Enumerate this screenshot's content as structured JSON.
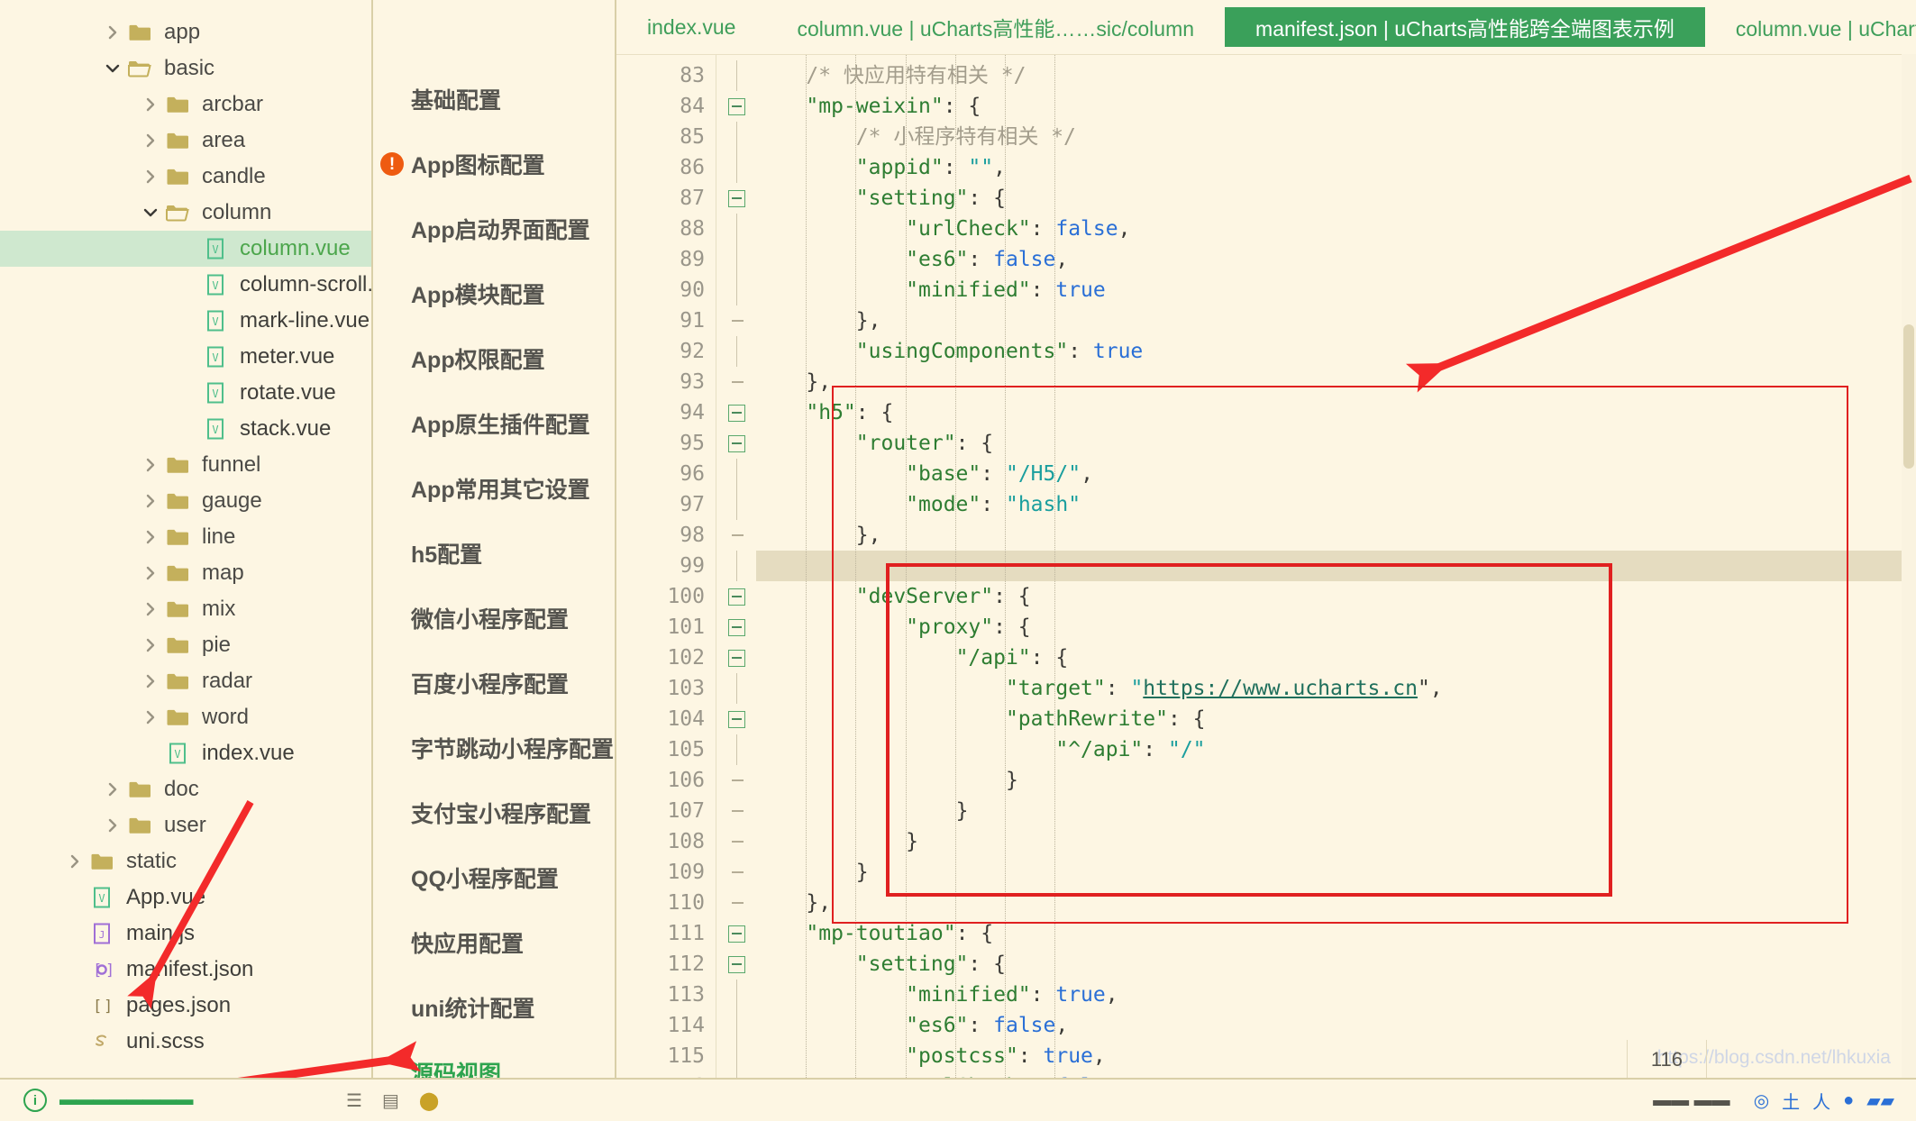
{
  "explorer": {
    "items": [
      {
        "label": "app",
        "type": "folder",
        "state": "collapsed",
        "depth": 1
      },
      {
        "label": "basic",
        "type": "folder-open",
        "state": "expanded",
        "depth": 1
      },
      {
        "label": "arcbar",
        "type": "folder",
        "state": "collapsed",
        "depth": 2
      },
      {
        "label": "area",
        "type": "folder",
        "state": "collapsed",
        "depth": 2
      },
      {
        "label": "candle",
        "type": "folder",
        "state": "collapsed",
        "depth": 2
      },
      {
        "label": "column",
        "type": "folder-open",
        "state": "expanded",
        "depth": 2
      },
      {
        "label": "column.vue",
        "type": "vue",
        "state": "selected",
        "depth": 3
      },
      {
        "label": "column-scroll.vue",
        "type": "vue",
        "state": "",
        "depth": 3
      },
      {
        "label": "mark-line.vue",
        "type": "vue",
        "state": "",
        "depth": 3
      },
      {
        "label": "meter.vue",
        "type": "vue",
        "state": "",
        "depth": 3
      },
      {
        "label": "rotate.vue",
        "type": "vue",
        "state": "",
        "depth": 3
      },
      {
        "label": "stack.vue",
        "type": "vue",
        "state": "",
        "depth": 3
      },
      {
        "label": "funnel",
        "type": "folder",
        "state": "collapsed",
        "depth": 2
      },
      {
        "label": "gauge",
        "type": "folder",
        "state": "collapsed",
        "depth": 2
      },
      {
        "label": "line",
        "type": "folder",
        "state": "collapsed",
        "depth": 2
      },
      {
        "label": "map",
        "type": "folder",
        "state": "collapsed",
        "depth": 2
      },
      {
        "label": "mix",
        "type": "folder",
        "state": "collapsed",
        "depth": 2
      },
      {
        "label": "pie",
        "type": "folder",
        "state": "collapsed",
        "depth": 2
      },
      {
        "label": "radar",
        "type": "folder",
        "state": "collapsed",
        "depth": 2
      },
      {
        "label": "word",
        "type": "folder",
        "state": "collapsed",
        "depth": 2
      },
      {
        "label": "index.vue",
        "type": "vue",
        "state": "",
        "depth": 2
      },
      {
        "label": "doc",
        "type": "folder",
        "state": "collapsed",
        "depth": 1
      },
      {
        "label": "user",
        "type": "folder",
        "state": "collapsed",
        "depth": 1
      },
      {
        "label": "static",
        "type": "folder",
        "state": "collapsed",
        "depth": 0
      },
      {
        "label": "App.vue",
        "type": "vue",
        "state": "",
        "depth": 0
      },
      {
        "label": "main.js",
        "type": "js",
        "state": "",
        "depth": 0
      },
      {
        "label": "manifest.json",
        "type": "manifest",
        "state": "",
        "depth": 0
      },
      {
        "label": "pages.json",
        "type": "pages",
        "state": "",
        "depth": 0
      },
      {
        "label": "uni.scss",
        "type": "scss",
        "state": "",
        "depth": 0
      }
    ]
  },
  "confignav": {
    "items": [
      {
        "label": "基础配置",
        "badge": "",
        "active": false
      },
      {
        "label": "App图标配置",
        "badge": "!",
        "active": false
      },
      {
        "label": "App启动界面配置",
        "badge": "",
        "active": false
      },
      {
        "label": "App模块配置",
        "badge": "",
        "active": false
      },
      {
        "label": "App权限配置",
        "badge": "",
        "active": false
      },
      {
        "label": "App原生插件配置",
        "badge": "",
        "active": false
      },
      {
        "label": "App常用其它设置",
        "badge": "",
        "active": false
      },
      {
        "label": "h5配置",
        "badge": "",
        "active": false
      },
      {
        "label": "微信小程序配置",
        "badge": "",
        "active": false
      },
      {
        "label": "百度小程序配置",
        "badge": "",
        "active": false
      },
      {
        "label": "字节跳动小程序配置",
        "badge": "",
        "active": false
      },
      {
        "label": "支付宝小程序配置",
        "badge": "",
        "active": false
      },
      {
        "label": "QQ小程序配置",
        "badge": "",
        "active": false
      },
      {
        "label": "快应用配置",
        "badge": "",
        "active": false
      },
      {
        "label": "uni统计配置",
        "badge": "",
        "active": false
      },
      {
        "label": "源码视图",
        "badge": "",
        "active": true
      }
    ]
  },
  "tabs": {
    "items": [
      {
        "label": "index.vue",
        "active": false
      },
      {
        "label": "column.vue | uCharts高性能……sic/column",
        "active": false
      },
      {
        "label": "manifest.json | uCharts高性能跨全端图表示例",
        "active": true
      },
      {
        "label": "column.vue | uCharts高性能……sic/colum",
        "active": false
      }
    ],
    "overflow_icon": "chevron-left-icon"
  },
  "code": {
    "first_line": 83,
    "highlight_line": 99,
    "lines": [
      {
        "n": 83,
        "fold": "bar",
        "indent": 1,
        "tokens": [
          {
            "t": "/* 快应用特有相关 */",
            "c": "cmt"
          }
        ]
      },
      {
        "n": 84,
        "fold": "box",
        "indent": 1,
        "tokens": [
          {
            "t": "\"mp-weixin\"",
            "c": "key"
          },
          {
            "t": ": {",
            "c": "pun"
          }
        ]
      },
      {
        "n": 85,
        "fold": "bar",
        "indent": 2,
        "tokens": [
          {
            "t": "/* 小程序特有相关 */",
            "c": "cmt"
          }
        ]
      },
      {
        "n": 86,
        "fold": "bar",
        "indent": 2,
        "tokens": [
          {
            "t": "\"appid\"",
            "c": "key"
          },
          {
            "t": ": ",
            "c": "pun"
          },
          {
            "t": "\"\"",
            "c": "str"
          },
          {
            "t": ",",
            "c": "pun"
          }
        ]
      },
      {
        "n": 87,
        "fold": "box",
        "indent": 2,
        "tokens": [
          {
            "t": "\"setting\"",
            "c": "key"
          },
          {
            "t": ": {",
            "c": "pun"
          }
        ]
      },
      {
        "n": 88,
        "fold": "bar",
        "indent": 3,
        "tokens": [
          {
            "t": "\"urlCheck\"",
            "c": "key"
          },
          {
            "t": ": ",
            "c": "pun"
          },
          {
            "t": "false",
            "c": "bool"
          },
          {
            "t": ",",
            "c": "pun"
          }
        ]
      },
      {
        "n": 89,
        "fold": "bar",
        "indent": 3,
        "tokens": [
          {
            "t": "\"es6\"",
            "c": "key"
          },
          {
            "t": ": ",
            "c": "pun"
          },
          {
            "t": "false",
            "c": "bool"
          },
          {
            "t": ",",
            "c": "pun"
          }
        ]
      },
      {
        "n": 90,
        "fold": "bar",
        "indent": 3,
        "tokens": [
          {
            "t": "\"minified\"",
            "c": "key"
          },
          {
            "t": ": ",
            "c": "pun"
          },
          {
            "t": "true",
            "c": "bool"
          }
        ]
      },
      {
        "n": 91,
        "fold": "dash",
        "indent": 2,
        "tokens": [
          {
            "t": "},",
            "c": "pun"
          }
        ]
      },
      {
        "n": 92,
        "fold": "bar",
        "indent": 2,
        "tokens": [
          {
            "t": "\"usingComponents\"",
            "c": "key"
          },
          {
            "t": ": ",
            "c": "pun"
          },
          {
            "t": "true",
            "c": "bool"
          }
        ]
      },
      {
        "n": 93,
        "fold": "dash",
        "indent": 1,
        "tokens": [
          {
            "t": "},",
            "c": "pun"
          }
        ]
      },
      {
        "n": 94,
        "fold": "box",
        "indent": 1,
        "tokens": [
          {
            "t": "\"h5\"",
            "c": "key"
          },
          {
            "t": ": {",
            "c": "pun"
          }
        ]
      },
      {
        "n": 95,
        "fold": "box",
        "indent": 2,
        "tokens": [
          {
            "t": "\"router\"",
            "c": "key"
          },
          {
            "t": ": {",
            "c": "pun"
          }
        ]
      },
      {
        "n": 96,
        "fold": "bar",
        "indent": 3,
        "tokens": [
          {
            "t": "\"base\"",
            "c": "key"
          },
          {
            "t": ": ",
            "c": "pun"
          },
          {
            "t": "\"/H5/\"",
            "c": "str"
          },
          {
            "t": ",",
            "c": "pun"
          }
        ]
      },
      {
        "n": 97,
        "fold": "bar",
        "indent": 3,
        "tokens": [
          {
            "t": "\"mode\"",
            "c": "key"
          },
          {
            "t": ": ",
            "c": "pun"
          },
          {
            "t": "\"hash\"",
            "c": "str"
          }
        ]
      },
      {
        "n": 98,
        "fold": "dash",
        "indent": 2,
        "tokens": [
          {
            "t": "},",
            "c": "pun"
          }
        ]
      },
      {
        "n": 99,
        "fold": "bar",
        "indent": 2,
        "tokens": []
      },
      {
        "n": 100,
        "fold": "box",
        "indent": 2,
        "tokens": [
          {
            "t": "\"devServer\"",
            "c": "key"
          },
          {
            "t": ": {",
            "c": "pun"
          }
        ]
      },
      {
        "n": 101,
        "fold": "box",
        "indent": 3,
        "tokens": [
          {
            "t": "\"proxy\"",
            "c": "key"
          },
          {
            "t": ": {",
            "c": "pun"
          }
        ]
      },
      {
        "n": 102,
        "fold": "box",
        "indent": 4,
        "tokens": [
          {
            "t": "\"/api\"",
            "c": "key"
          },
          {
            "t": ": {",
            "c": "pun"
          }
        ]
      },
      {
        "n": 103,
        "fold": "bar",
        "indent": 5,
        "tokens": [
          {
            "t": "\"target\"",
            "c": "key"
          },
          {
            "t": ": ",
            "c": "pun"
          },
          {
            "t": "\"",
            "c": "str"
          },
          {
            "t": "https://www.ucharts.cn",
            "c": "url"
          },
          {
            "t": "\",",
            "c": "pun"
          }
        ]
      },
      {
        "n": 104,
        "fold": "box",
        "indent": 5,
        "tokens": [
          {
            "t": "\"pathRewrite\"",
            "c": "key"
          },
          {
            "t": ": {",
            "c": "pun"
          }
        ]
      },
      {
        "n": 105,
        "fold": "bar",
        "indent": 6,
        "tokens": [
          {
            "t": "\"^/api\"",
            "c": "key"
          },
          {
            "t": ": ",
            "c": "pun"
          },
          {
            "t": "\"/\"",
            "c": "str"
          }
        ]
      },
      {
        "n": 106,
        "fold": "dash",
        "indent": 5,
        "tokens": [
          {
            "t": "}",
            "c": "pun"
          }
        ]
      },
      {
        "n": 107,
        "fold": "dash",
        "indent": 4,
        "tokens": [
          {
            "t": "}",
            "c": "pun"
          }
        ]
      },
      {
        "n": 108,
        "fold": "dash",
        "indent": 3,
        "tokens": [
          {
            "t": "}",
            "c": "pun"
          }
        ]
      },
      {
        "n": 109,
        "fold": "dash",
        "indent": 2,
        "tokens": [
          {
            "t": "}",
            "c": "pun"
          }
        ]
      },
      {
        "n": 110,
        "fold": "dash",
        "indent": 1,
        "tokens": [
          {
            "t": "},",
            "c": "pun"
          }
        ]
      },
      {
        "n": 111,
        "fold": "box",
        "indent": 1,
        "tokens": [
          {
            "t": "\"mp-toutiao\"",
            "c": "key"
          },
          {
            "t": ": {",
            "c": "pun"
          }
        ]
      },
      {
        "n": 112,
        "fold": "box",
        "indent": 2,
        "tokens": [
          {
            "t": "\"setting\"",
            "c": "key"
          },
          {
            "t": ": {",
            "c": "pun"
          }
        ]
      },
      {
        "n": 113,
        "fold": "bar",
        "indent": 3,
        "tokens": [
          {
            "t": "\"minified\"",
            "c": "key"
          },
          {
            "t": ": ",
            "c": "pun"
          },
          {
            "t": "true",
            "c": "bool"
          },
          {
            "t": ",",
            "c": "pun"
          }
        ]
      },
      {
        "n": 114,
        "fold": "bar",
        "indent": 3,
        "tokens": [
          {
            "t": "\"es6\"",
            "c": "key"
          },
          {
            "t": ": ",
            "c": "pun"
          },
          {
            "t": "false",
            "c": "bool"
          },
          {
            "t": ",",
            "c": "pun"
          }
        ]
      },
      {
        "n": 115,
        "fold": "bar",
        "indent": 3,
        "tokens": [
          {
            "t": "\"postcss\"",
            "c": "key"
          },
          {
            "t": ": ",
            "c": "pun"
          },
          {
            "t": "true",
            "c": "bool"
          },
          {
            "t": ",",
            "c": "pun"
          }
        ]
      },
      {
        "n": 116,
        "fold": "bar",
        "indent": 3,
        "tokens": [
          {
            "t": "\"urlCheck\"",
            "c": "key"
          },
          {
            "t": ": ",
            "c": "pun"
          },
          {
            "t": "false",
            "c": "bool"
          }
        ]
      }
    ]
  },
  "statusbar": {
    "line_count": "116",
    "watermark": "https://blog.csdn.net/lhkuxia"
  },
  "colors": {
    "background": "#fdf6e3",
    "accent_green": "#3aa05a",
    "annotation_red": "#e02020",
    "warning_orange": "#ee5b11",
    "selection_green": "#cfe8cf",
    "highlight_line": "#e5dcc0"
  }
}
